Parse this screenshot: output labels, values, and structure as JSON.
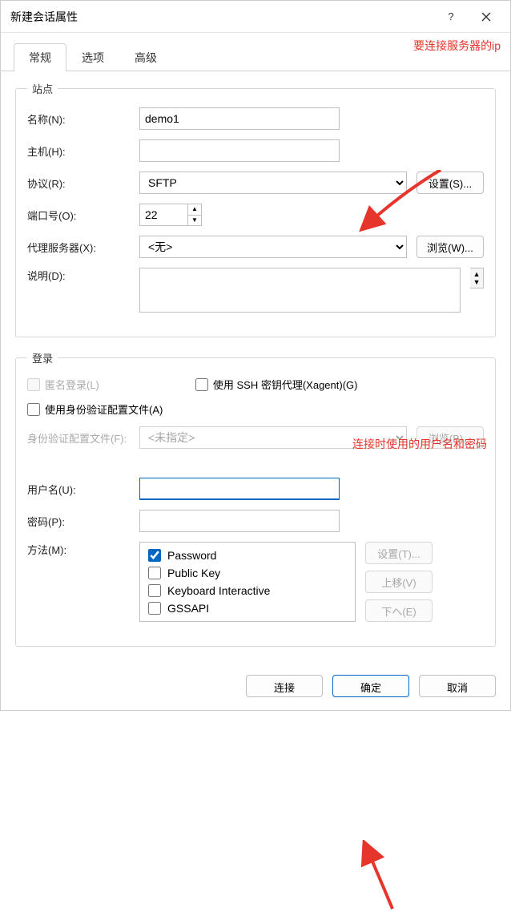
{
  "window": {
    "title": "新建会话属性"
  },
  "tabs": {
    "t0": "常规",
    "t1": "选项",
    "t2": "高级"
  },
  "annotations": {
    "server_ip": "要连接服务器的ip",
    "user_pass": "连接时使用的用户名和密码"
  },
  "site": {
    "legend": "站点",
    "name_label": "名称(N):",
    "name_value": "demo1",
    "host_label": "主机(H):",
    "host_value": "",
    "protocol_label": "协议(R):",
    "protocol_value": "SFTP",
    "settings_btn": "设置(S)...",
    "port_label": "端口号(O):",
    "port_value": "22",
    "proxy_label": "代理服务器(X):",
    "proxy_value": "<无>",
    "browse_btn": "浏览(W)...",
    "desc_label": "说明(D):",
    "desc_value": ""
  },
  "login": {
    "legend": "登录",
    "anon_label": "匿名登录(L)",
    "xagent_label": "使用 SSH 密钥代理(Xagent)(G)",
    "authfile_label": "使用身份验证配置文件(A)",
    "authprofile_label": "身份验证配置文件(F):",
    "authprofile_value": "<未指定>",
    "browse_btn": "浏览(B)...",
    "user_label": "用户名(U):",
    "user_value": "",
    "pass_label": "密码(P):",
    "pass_value": "",
    "method_label": "方法(M):",
    "methods": {
      "m0": "Password",
      "m1": "Public Key",
      "m2": "Keyboard Interactive",
      "m3": "GSSAPI"
    },
    "settings_btn": "设置(T)...",
    "up_btn": "上移(V)",
    "down_btn": "下へ(E)"
  },
  "footer": {
    "connect": "连接",
    "ok": "确定",
    "cancel": "取消"
  }
}
